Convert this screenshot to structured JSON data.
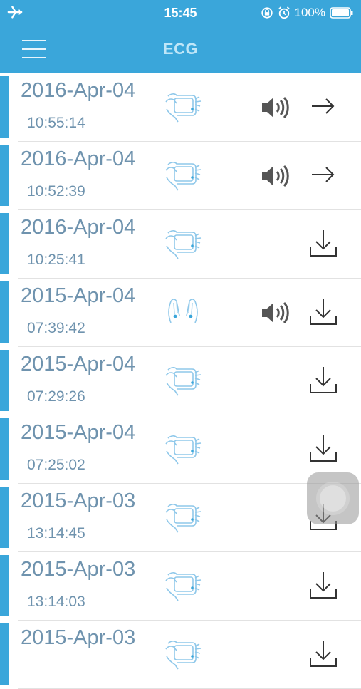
{
  "status": {
    "time": "15:45",
    "battery": "100%"
  },
  "nav": {
    "title": "ECG",
    "menu_icon": "hamburger-menu-icon"
  },
  "colors": {
    "accent": "#3aa6da",
    "text": "#6f93ae"
  },
  "records": [
    {
      "date": "2016-Apr-04",
      "time": "10:55:14",
      "mode": "hand-device",
      "has_audio": true,
      "action": "arrow"
    },
    {
      "date": "2016-Apr-04",
      "time": "10:52:39",
      "mode": "hand-device",
      "has_audio": true,
      "action": "arrow"
    },
    {
      "date": "2016-Apr-04",
      "time": "10:25:41",
      "mode": "hand-device",
      "has_audio": false,
      "action": "download"
    },
    {
      "date": "2015-Apr-04",
      "time": "07:39:42",
      "mode": "two-hands",
      "has_audio": true,
      "action": "download"
    },
    {
      "date": "2015-Apr-04",
      "time": "07:29:26",
      "mode": "hand-device",
      "has_audio": false,
      "action": "download"
    },
    {
      "date": "2015-Apr-04",
      "time": "07:25:02",
      "mode": "hand-device",
      "has_audio": false,
      "action": "download"
    },
    {
      "date": "2015-Apr-03",
      "time": "13:14:45",
      "mode": "hand-device",
      "has_audio": false,
      "action": "download"
    },
    {
      "date": "2015-Apr-03",
      "time": "13:14:03",
      "mode": "hand-device",
      "has_audio": false,
      "action": "download"
    },
    {
      "date": "2015-Apr-03",
      "time": "",
      "mode": "hand-device",
      "has_audio": false,
      "action": "download"
    }
  ]
}
